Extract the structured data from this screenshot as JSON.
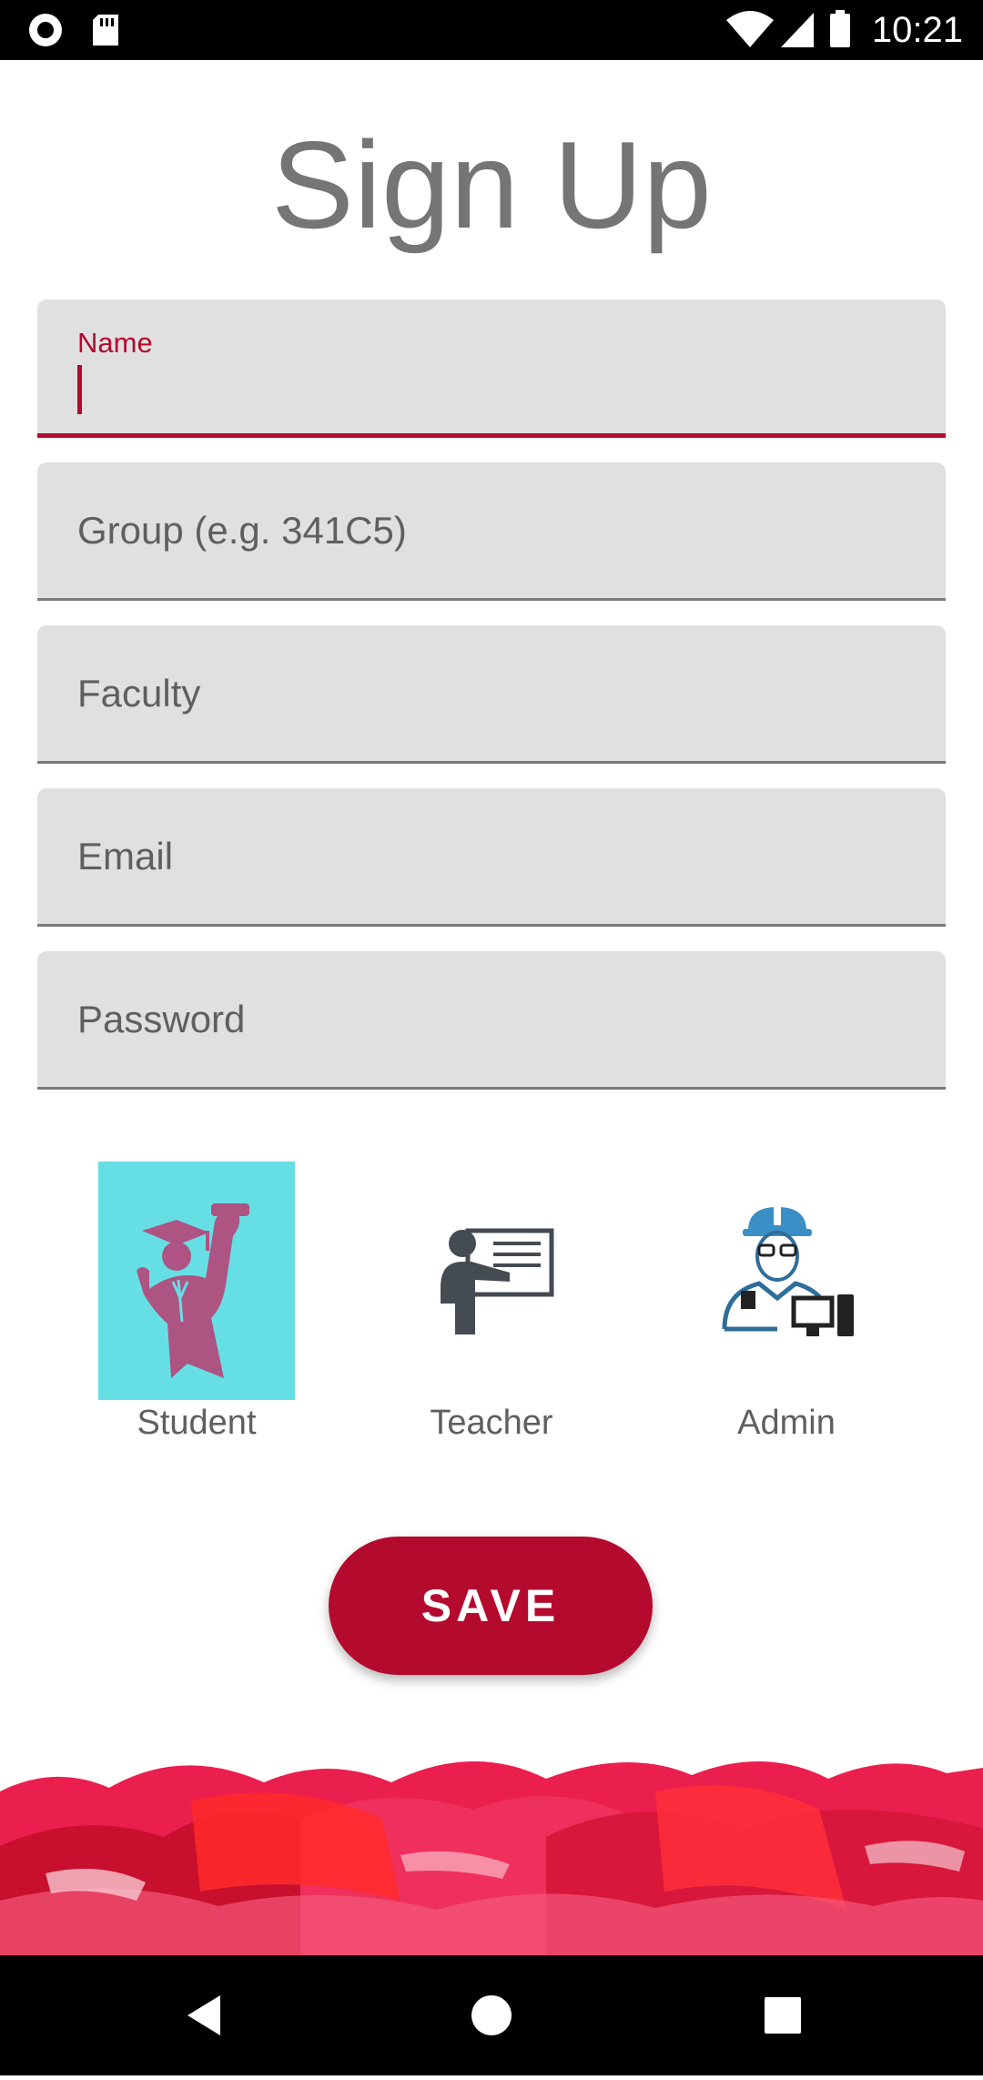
{
  "status_bar": {
    "time": "10:21",
    "left_icons": [
      "record-icon",
      "sd-card-icon"
    ],
    "right_icons": [
      "wifi-icon",
      "cell-signal-icon",
      "battery-icon"
    ]
  },
  "page": {
    "title": "Sign Up"
  },
  "form": {
    "name": {
      "label": "Name",
      "value": ""
    },
    "group": {
      "placeholder": "Group (e.g. 341C5)",
      "value": ""
    },
    "faculty": {
      "placeholder": "Faculty",
      "value": ""
    },
    "email": {
      "placeholder": "Email",
      "value": ""
    },
    "password": {
      "placeholder": "Password",
      "value": ""
    }
  },
  "roles": {
    "selected": "Student",
    "student": {
      "label": "Student",
      "icon": "graduate-icon"
    },
    "teacher": {
      "label": "Teacher",
      "icon": "teacher-icon"
    },
    "admin": {
      "label": "Admin",
      "icon": "admin-icon"
    }
  },
  "actions": {
    "save_label": "SAVE"
  },
  "nav": {
    "icons": [
      "back-icon",
      "home-icon",
      "recents-icon"
    ]
  },
  "colors": {
    "accent": "#b40a2e",
    "field_background": "#e0e0e0",
    "selected_role_background": "#66dfe4",
    "title_text": "#757575"
  }
}
